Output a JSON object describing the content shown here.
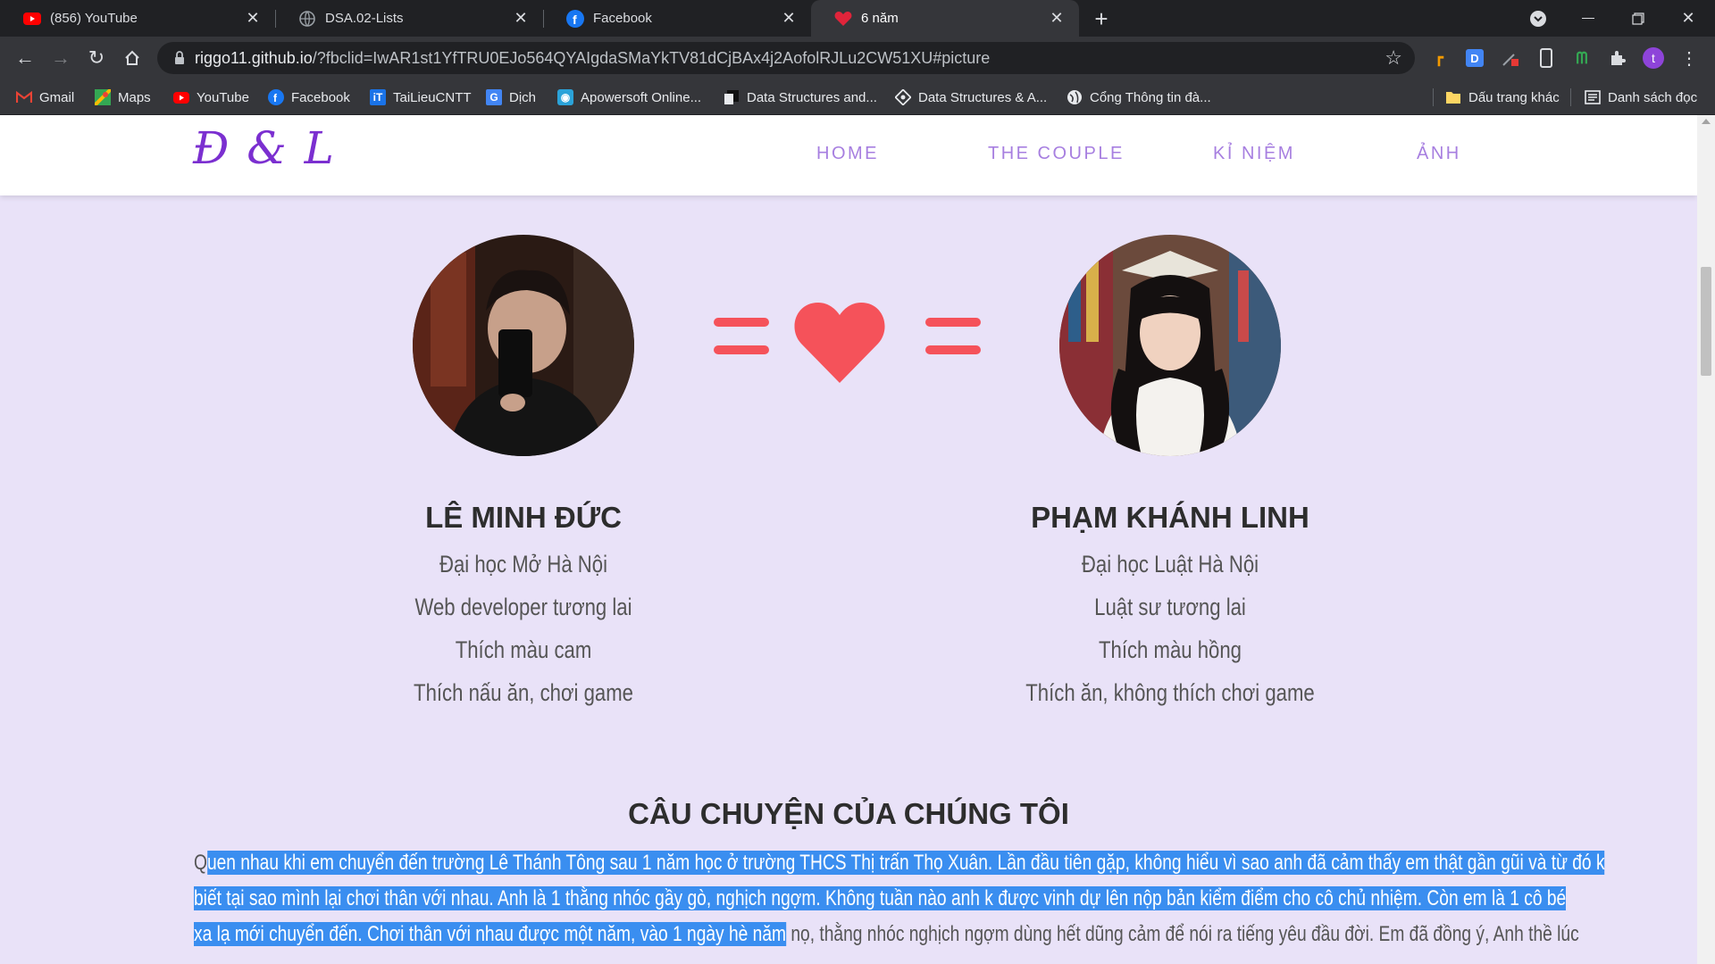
{
  "browser": {
    "tabs": [
      {
        "title": "(856) YouTube",
        "icon": "youtube-icon"
      },
      {
        "title": "DSA.02-Lists",
        "icon": "globe-icon"
      },
      {
        "title": "Facebook",
        "icon": "facebook-icon"
      },
      {
        "title": "6 năm",
        "icon": "heart-icon",
        "active": true
      }
    ],
    "url_host": "riggo11.github.io",
    "url_rest": "/?fbclid=IwAR1st1YfTRU0EJo564QYAIgdaSMaYkTV81dCjBAx4j2AofolRJLu2CW51XU#picture",
    "profile_initial": "t",
    "extension_d": "D",
    "bookmarks": [
      {
        "label": "Gmail",
        "icon": "gmail-icon"
      },
      {
        "label": "Maps",
        "icon": "maps-icon"
      },
      {
        "label": "YouTube",
        "icon": "youtube-icon"
      },
      {
        "label": "Facebook",
        "icon": "facebook-icon"
      },
      {
        "label": "TaiLieuCNTT",
        "icon": "tailieu-icon"
      },
      {
        "label": "Dịch",
        "icon": "translate-icon"
      },
      {
        "label": "Apowersoft Online...",
        "icon": "apowersoft-icon"
      },
      {
        "label": "Data Structures and...",
        "icon": "document-icon"
      },
      {
        "label": "Data Structures & A...",
        "icon": "diamond-icon"
      },
      {
        "label": "Cổng Thông tin đà...",
        "icon": "globe-icon"
      }
    ],
    "other_bookmarks": "Dấu trang khác",
    "reading_list": "Danh sách đọc"
  },
  "site": {
    "brand": "Đ & L",
    "nav": [
      "HOME",
      "THE COUPLE",
      "KỈ NIỆM",
      "ẢNH"
    ],
    "colors": {
      "accent": "#7b2fd0",
      "heart": "#f5525a",
      "background": "#e9e2f8"
    },
    "person1": {
      "name": "LÊ MINH ĐỨC",
      "lines": [
        "Đại học Mở Hà Nội",
        "Web developer tương lai",
        "Thích màu cam",
        "Thích nấu ăn, chơi game"
      ]
    },
    "person2": {
      "name": "PHẠM KHÁNH LINH",
      "lines": [
        "Đại học Luật Hà Nội",
        "Luật sư tương lai",
        "Thích màu hồng",
        "Thích ăn, không thích chơi game"
      ]
    },
    "story": {
      "title": "CÂU CHUYỆN CỦA CHÚNG TÔI",
      "line1_pre": "Q",
      "line1_sel": "uen nhau khi em chuyển đến trường Lê Thánh Tông sau 1 năm học ở trường THCS Thị trấn Thọ Xuân. Lần đầu tiên gặp, không hiểu vì sao anh đã cảm thấy em thật gần gũi và từ đó k",
      "line2_sel": "biết tại sao mình lại chơi thân với nhau. Anh là 1 thằng nhóc gầy gò, nghịch ngợm. Không tuần nào anh k được vinh dự lên nộp bản kiểm điểm cho cô chủ nhiệm. Còn em là 1 cô bé",
      "line3_sel": "xa lạ mới chuyển đến. Chơi thân với nhau được một năm, vào 1 ngày hè năm",
      "line3_rest": " nọ, thằng nhóc nghịch ngợm dùng hết dũng cảm để nói ra tiếng yêu đầu đời. Em đã đồng ý, Anh thề lúc"
    }
  }
}
